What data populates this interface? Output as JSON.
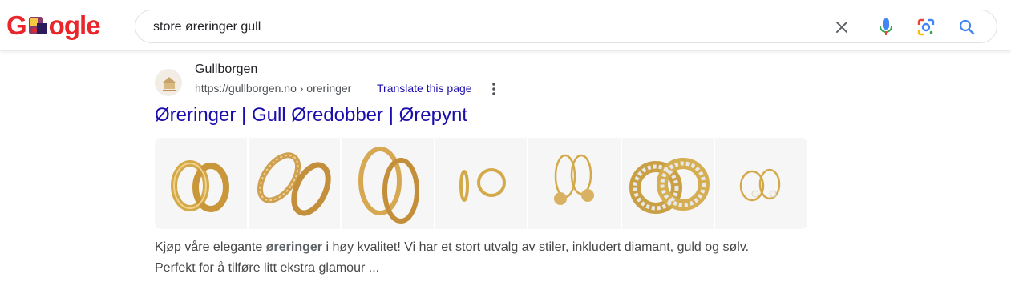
{
  "logo": {
    "letters": [
      "G",
      "o",
      "g",
      "l",
      "e"
    ],
    "colors": [
      "#e8262b",
      "#e8262b",
      "#e8262b",
      "#e8262b",
      "#e8262b"
    ]
  },
  "search": {
    "query": "store øreringer gull"
  },
  "icons": {
    "clear": "close-icon",
    "voice": "microphone-icon",
    "lens": "lens-icon",
    "search": "search-icon"
  },
  "result": {
    "site_name": "Gullborgen",
    "url": "https://gullborgen.no › oreringer",
    "translate": "Translate this page",
    "title": "Øreringer | Gull Øredobber | Ørepynt",
    "snippet_before": "Kjøp våre elegante ",
    "snippet_bold": "øreringer",
    "snippet_after": " i høy kvalitet! Vi har et stort utvalg av stiler, inkludert diamant, guld og sølv.",
    "snippet_line2": "Perfekt for å tilføre litt ekstra glamour ..."
  },
  "colors": {
    "link": "#1a0dab",
    "gold": "#d4a94a"
  }
}
